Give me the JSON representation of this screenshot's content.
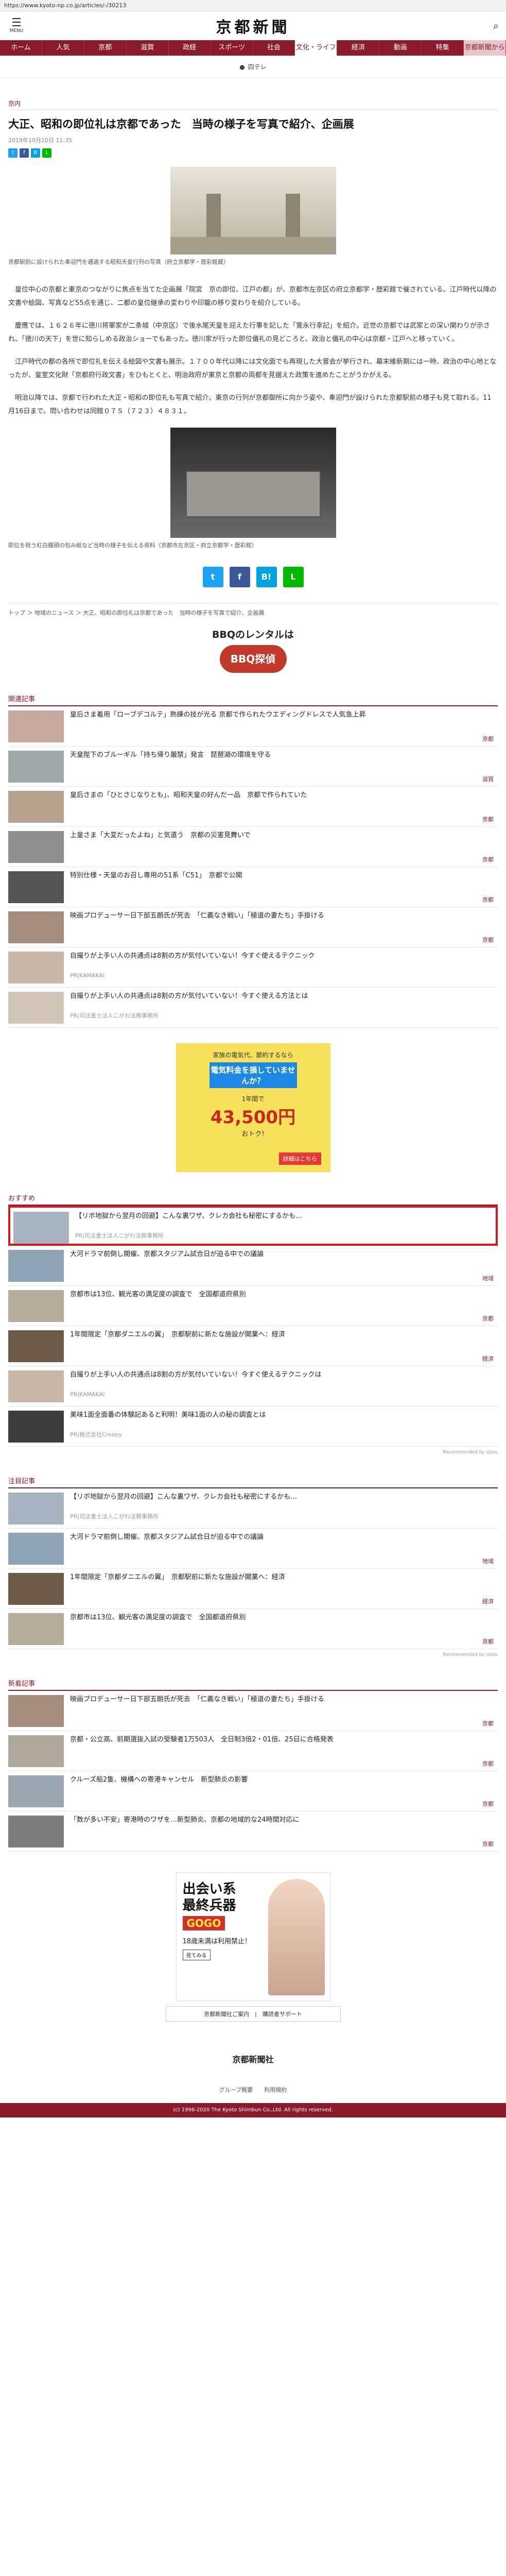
{
  "browser": {
    "url": "https://www.kyoto-np.co.jp/articles/-/30213"
  },
  "header": {
    "menu_label": "MENU",
    "logo": "京都新聞"
  },
  "nav": [
    "ホーム",
    "人気",
    "京都",
    "滋賀",
    "政経",
    "スポーツ",
    "社会",
    "文化・ライフ",
    "経済",
    "動画",
    "特集",
    "京都新聞から"
  ],
  "ad_strip": "四テレ",
  "article": {
    "category": "京内",
    "headline": "大正、昭和の即位礼は京都であった　当時の様子を写真で紹介、企画展",
    "date": "2019年10月20日 11:35",
    "caption1": "京都駅前に設けられた奉迎門を通過する昭和天皇行列の写真（府立京都学・歴彩館蔵）",
    "caption2": "即位を祝う紅白饅頭の包み紙など当時の様子を伝える資料（京都市左京区・府立京都学・歴彩館）",
    "paragraphs": [
      "皇位中心の京都と東京のつながりに焦点を当てた企画展「院宮　京の即位、江戸の都」が、京都市左京区の府立京都学・歴彩館で催されている。江戸時代以降の文書や絵図、写真など55点を通じ、二都の皇位継承の変わりや印籠の移り変わりを紹介している。",
      "慶應では、１６２６年に徳川将軍家が二条城（中京区）で後水尾天皇を迎えた行事を記した「寛永行幸記」を紹介。近世の京都では武家との深い関わりが示され、「徳川の天下」を世に知らしめる政治ショーでもあった。徳川家が行った即位儀礼の見どころと、政治と儀礼の中心は京都・江戸へと移っていく。",
      "江戸時代の都の各所で即位礼を伝える絵図や文書も展示。１７００年代以降には文化面でも再現した大嘗会が挙行され、幕末維新期には一時、政治の中心地となったが、皇室文化財「京都府行政文書」をひもとくと、明治政府が東京と京都の両都を見据えた政策を進めたことがうかがえる。",
      "明治以降では、京都で行われた大正・昭和の即位礼も写真で紹介。東京の行列が京都御所に向かう姿や、奉迎門が設けられた京都駅前の様子も見て取れる。11月16日まで。問い合わせは同館０７５（７２３）４８３１。"
    ]
  },
  "breadcrumb": "トップ ＞ 地域のニュース ＞ 大正、昭和の即位礼は京都であった　当時の様子を写真で紹介、企画展",
  "bbq_ad": {
    "line1": "BBQのレンタルは",
    "brand": "BBQ探偵"
  },
  "related": {
    "title": "関連記事",
    "items": [
      {
        "text": "皇后さま着用「ローブデコルテ」熟練の技が光る 京都で作られたウエディングドレスで人気急上昇",
        "tag": "京都"
      },
      {
        "text": "天皇陛下のブルーギル「持ち帰り厳禁」発言　琵琶湖の環境を守る",
        "tag": "滋賀"
      },
      {
        "text": "皇后さまの「ひとさじなりとも」、昭和天皇の好んだ一品　京都で作られていた",
        "tag": "京都"
      },
      {
        "text": "上皇さま「大変だったよね」と気遣う　京都の災害見舞いで",
        "tag": "京都"
      },
      {
        "text": "特別仕様・天皇のお召し専用の51系「C51」　京都で公開",
        "tag": "京都"
      },
      {
        "text": "映画プロデューサー日下部五朗氏が死去　「仁義なき戦い」「極道の妻たち」手掛ける",
        "tag": "京都"
      },
      {
        "text": "自撮りが上手い人の共通点は8割の方が気付いていない！今すぐ使えるテクニック",
        "source": "PR|KAMAKAI",
        "tag": ""
      },
      {
        "text": "自撮りが上手い人の共通点は8割の方が気付いていない！今すぐ使える方法とは",
        "source": "PR|司法書士法人こがわ法務事務所",
        "tag": ""
      }
    ]
  },
  "yellow_ad": {
    "t1": "家族の電気代、節約するなら",
    "t2": "電気料金を損していませんか？",
    "t3": "1年間で",
    "t4": "43,500円",
    "t5": "おトク!",
    "t6": "詳細はこちら"
  },
  "recommended": {
    "title": "おすすめ",
    "items": [
      {
        "text": "【リボ地獄から翌月の回避】こんな裏ワザ、クレカ会社も秘密にするかも…",
        "source": "PR|司法書士法人こがわ法務事務所",
        "tag": "",
        "highlight": true
      },
      {
        "text": "大河ドラマ前倒し開催、京都スタジアム試合日が迫る中での議論",
        "tag": "地域"
      },
      {
        "text": "京都市は13位、観光客の満足度の調査で　全国都道府県別",
        "tag": "京都"
      },
      {
        "text": "1年間限定「京都ダニエルの翼」　京都駅前に新たな施設が開業へ：経済",
        "tag": "経済"
      },
      {
        "text": "自撮りが上手い人の共通点は8割の方が気付いていない！今すぐ使えるテクニックは",
        "source": "PR|KAMAKAI",
        "tag": ""
      },
      {
        "text": "美味1面全面番の体験記あると利明！美味1面の人の秘の調査とは",
        "source": "PR|株式会社Creapy",
        "tag": ""
      }
    ],
    "credit": "Recommended by Uzou"
  },
  "attention": {
    "title": "注目記事",
    "items": [
      {
        "text": "【リボ地獄から翌月の回避】こんな裏ワザ、クレカ会社も秘密にするかも…",
        "source": "PR|司法書士法人こがわ法務事務所",
        "tag": ""
      },
      {
        "text": "大河ドラマ前倒し開催、京都スタジアム試合日が迫る中での議論",
        "tag": "地域"
      },
      {
        "text": "1年間限定「京都ダニエルの翼」　京都駅前に新たな施設が開業へ：経済",
        "tag": "経済"
      },
      {
        "text": "京都市は13位、観光客の満足度の調査で　全国都道府県別",
        "tag": "京都"
      }
    ],
    "credit": "Recommended by Uzou"
  },
  "newest": {
    "title": "新着記事",
    "items": [
      {
        "text": "映画プロデューサー日下部五朗氏が死去　「仁義なき戦い」「極道の妻たち」手掛ける",
        "tag": "京都"
      },
      {
        "text": "京都・公立高、前期選抜入試の受験者1万503人　全日制3倍2・01倍、25日に合格発表",
        "tag": "京都"
      },
      {
        "text": "クルーズ船2隻、機構への寄港キャンセル　新型肺炎の影響",
        "tag": "京都"
      },
      {
        "text": "「数が多い不安」寄港時のワザを…新型肺炎、京都の地域的な24時間対応に",
        "tag": "京都"
      }
    ]
  },
  "dating_ad": {
    "a1": "出会い系\n最終兵器",
    "a2": "GOGO",
    "a3": "18歳未満は利用禁止！",
    "a4": "見てみる"
  },
  "links_box": "京都新聞社ご案内　|　購読者サポート",
  "footer": {
    "logo": "京都新聞社",
    "links": "グループ概要　　利用規約",
    "copyright": "(c) 1996-2020 The Kyoto Shimbun Co.,Ltd. All rights reserved."
  }
}
